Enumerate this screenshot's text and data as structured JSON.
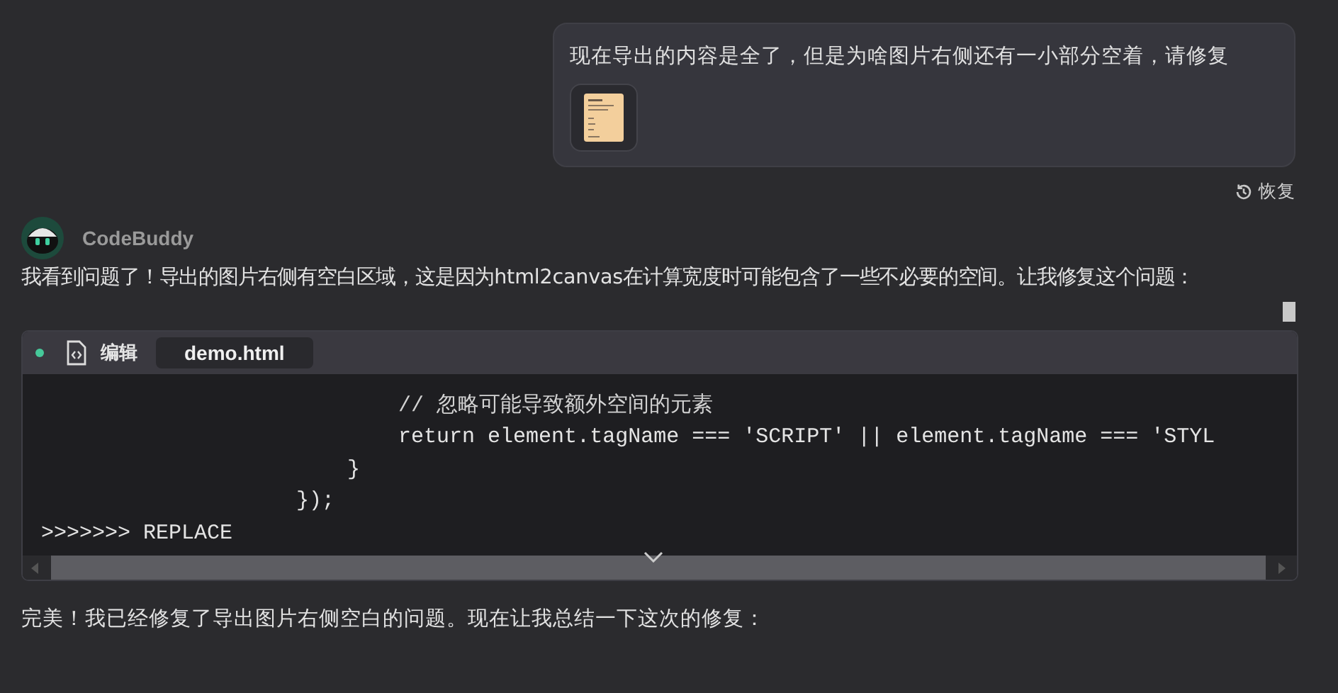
{
  "user_message": {
    "text": "现在导出的内容是全了，但是为啥图片右侧还有一小部分空着，请修复",
    "has_attachment": true
  },
  "restore_link": "恢复",
  "assistant": {
    "name": "CodeBuddy",
    "message": "我看到问题了！导出的图片右侧有空白区域，这是因为html2canvas在计算宽度时可能包含了一些不必要的空间。让我修复这个问题："
  },
  "code_block": {
    "status_dot": true,
    "action": "编辑",
    "file_tab": "demo.html",
    "lines": [
      {
        "kind": "comment",
        "text": "                            // 忽略可能导致额外空间的元素"
      },
      {
        "kind": "code",
        "text": "                            return element.tagName === 'SCRIPT' || element.tagName === 'STYL"
      },
      {
        "kind": "code",
        "text": "                        }"
      },
      {
        "kind": "code",
        "text": "                    });"
      },
      {
        "kind": "code",
        "text": ">>>>>>> REPLACE"
      }
    ]
  },
  "final_message": "完美！我已经修复了导出图片右侧空白的问题。现在让我总结一下这次的修复："
}
